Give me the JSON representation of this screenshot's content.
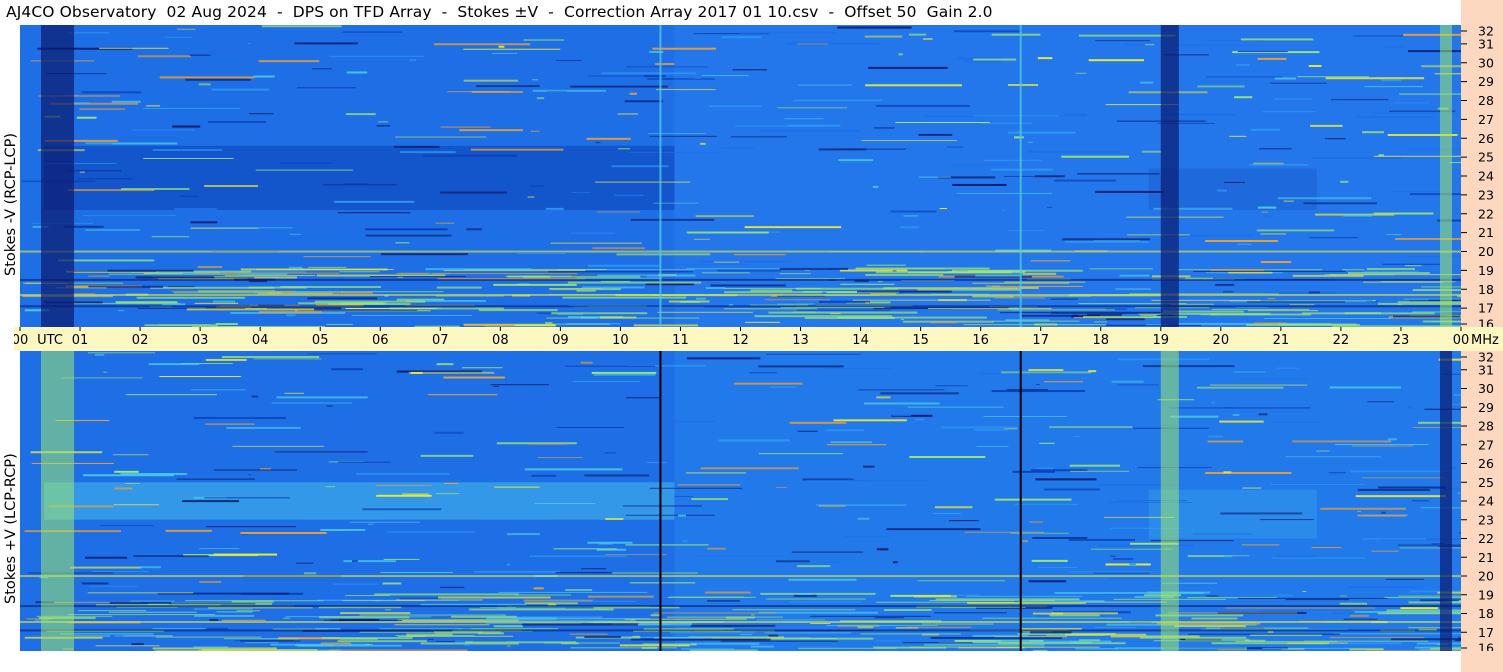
{
  "title": "AJ4CO Observatory  02 Aug 2024  -  DPS on TFD Array  -  Stokes ±V  -  Correction Array 2017 01 10.csv  -  Offset 50  Gain 2.0",
  "chart_data": [
    {
      "type": "heatmap",
      "panel": "top",
      "ylabel": "Stokes -V (RCP-LCP)",
      "x_ticks": [
        "00",
        "01",
        "02",
        "03",
        "04",
        "05",
        "06",
        "07",
        "08",
        "09",
        "10",
        "11",
        "12",
        "13",
        "14",
        "15",
        "16",
        "17",
        "18",
        "19",
        "20",
        "21",
        "22",
        "23",
        "00"
      ],
      "x_unit": "UTC",
      "y_ticks": [
        16,
        17,
        18,
        19,
        20,
        21,
        22,
        23,
        24,
        25,
        26,
        27,
        28,
        29,
        30,
        31,
        32
      ],
      "y_unit": "MHz",
      "xlim": [
        0,
        24
      ],
      "ylim": [
        16,
        32
      ],
      "colormap": [
        "#0a1a6e",
        "#0b3fb5",
        "#1d6fe8",
        "#2e9af2",
        "#4cc9e8",
        "#9de870",
        "#e8e838",
        "#f0a030"
      ],
      "events": [
        {
          "utc_start": 0.35,
          "utc_end": 0.9,
          "feature": "dark vertical band"
        },
        {
          "utc_start": 10.65,
          "utc_end": 10.68,
          "feature": "vertical line"
        },
        {
          "utc_start": 16.65,
          "utc_end": 16.68,
          "feature": "vertical line"
        },
        {
          "utc_start": 19.0,
          "utc_end": 19.3,
          "feature": "dark vertical band"
        },
        {
          "utc_start": 23.65,
          "utc_end": 23.85,
          "feature": "bright vertical band"
        }
      ]
    },
    {
      "type": "heatmap",
      "panel": "bottom",
      "ylabel": "Stokes +V (LCP-RCP)",
      "x_ticks": [
        "00",
        "01",
        "02",
        "03",
        "04",
        "05",
        "06",
        "07",
        "08",
        "09",
        "10",
        "11",
        "12",
        "13",
        "14",
        "15",
        "16",
        "17",
        "18",
        "19",
        "20",
        "21",
        "22",
        "23",
        "00"
      ],
      "x_unit": "UTC",
      "y_ticks": [
        16,
        17,
        18,
        19,
        20,
        21,
        22,
        23,
        24,
        25,
        26,
        27,
        28,
        29,
        30,
        31,
        32
      ],
      "y_unit": "MHz",
      "xlim": [
        0,
        24
      ],
      "ylim": [
        16,
        32
      ],
      "colormap": [
        "#0a1a6e",
        "#0b3fb5",
        "#1d6fe8",
        "#2e9af2",
        "#4cc9e8",
        "#9de870",
        "#e8e838",
        "#f0a030"
      ],
      "events": [
        {
          "utc_start": 0.35,
          "utc_end": 0.9,
          "feature": "bright vertical band"
        },
        {
          "utc_start": 10.65,
          "utc_end": 10.68,
          "feature": "black vertical line"
        },
        {
          "utc_start": 16.65,
          "utc_end": 16.68,
          "feature": "black vertical line"
        },
        {
          "utc_start": 19.0,
          "utc_end": 19.3,
          "feature": "bright vertical band"
        },
        {
          "utc_start": 23.65,
          "utc_end": 23.85,
          "feature": "dark vertical band"
        }
      ]
    }
  ],
  "colors": {
    "freq_axis_bg": "#fcd8c0",
    "time_axis_bg": "#fdf7c2",
    "base_field": "#1e6fe6"
  }
}
